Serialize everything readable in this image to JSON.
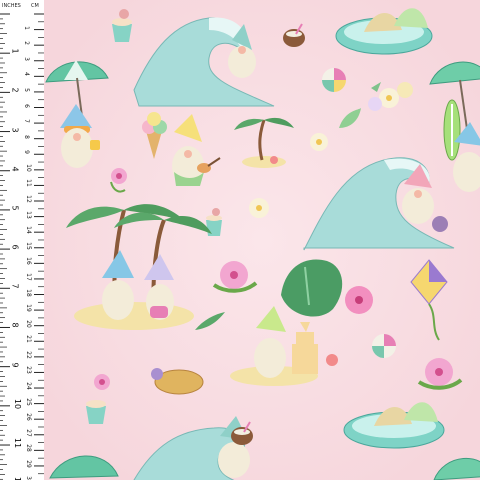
{
  "ruler": {
    "unit_left": "INCHES",
    "unit_right": "CM",
    "inch_labels": [
      "1",
      "2",
      "3",
      "4",
      "5",
      "6",
      "7",
      "8",
      "9",
      "10",
      "11",
      "12"
    ],
    "cm_labels": [
      "1",
      "2",
      "3",
      "4",
      "5",
      "6",
      "7",
      "8",
      "9",
      "10",
      "11",
      "12",
      "13",
      "14",
      "15",
      "16",
      "17",
      "18",
      "19",
      "20",
      "21",
      "22",
      "23",
      "24",
      "25",
      "26",
      "27",
      "28",
      "29",
      "30"
    ]
  },
  "motifs": [
    "gnome-on-wave",
    "beach-umbrella",
    "palm-trees",
    "gnome-with-ukulele",
    "ice-cream-cone",
    "beach-ball",
    "coconut-drink",
    "hibiscus-flower",
    "monstera-leaf",
    "kite",
    "sandcastle",
    "turtle-float",
    "surfboard",
    "sand-bucket",
    "paddling-pool"
  ],
  "colors": {
    "background": "#f9dfe3",
    "wave": "#9fd6d4",
    "leaf": "#5a9b55",
    "sand": "#f4e3a8",
    "accent": "#e77fb5"
  }
}
